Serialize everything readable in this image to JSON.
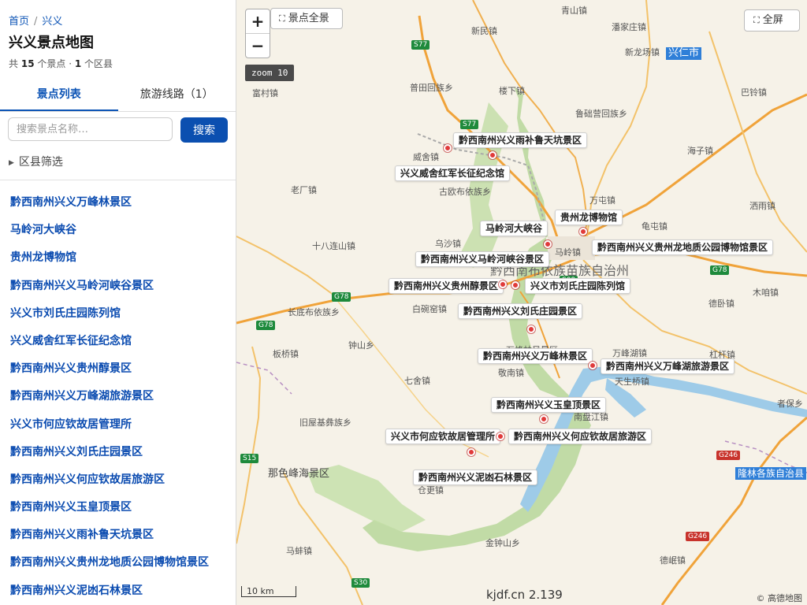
{
  "breadcrumb": {
    "home": "首页",
    "region": "兴义"
  },
  "page": {
    "title": "兴义景点地图",
    "count_prefix": "共",
    "spot_count": "15",
    "spot_unit": "个景点 ·",
    "district_count": "1",
    "district_unit": "个区县"
  },
  "tabs": [
    {
      "label": "景点列表",
      "active": true
    },
    {
      "label": "旅游线路（1）",
      "active": false
    }
  ],
  "search": {
    "placeholder": "搜索景点名称…",
    "button": "搜索"
  },
  "filter": {
    "label": "区县筛选"
  },
  "spots": [
    "黔西南州兴义万峰林景区",
    "马岭河大峡谷",
    "贵州龙博物馆",
    "黔西南州兴义马岭河峡谷景区",
    "兴义市刘氏庄园陈列馆",
    "兴义威舍红军长征纪念馆",
    "黔西南州兴义贵州醇景区",
    "黔西南州兴义万峰湖旅游景区",
    "兴义市何应钦故居管理所",
    "黔西南州兴义刘氏庄园景区",
    "黔西南州兴义何应钦故居旅游区",
    "黔西南州兴义玉皇顶景区",
    "黔西南州兴义雨补鲁天坑景区",
    "黔西南州兴义贵州龙地质公园博物馆景区",
    "黔西南州兴义泥凼石林景区"
  ],
  "map": {
    "zoom_in": "+",
    "zoom_out": "−",
    "overview_button": "景点全景",
    "fullscreen_button": "全屏",
    "zoom_badge": "zoom 10",
    "scale": "10 km",
    "watermark": "kjdf.cn 2.139",
    "copyright": "© 高德地图",
    "labels": [
      "黔西南州兴义雨补鲁天坑景区",
      "兴义威舍红军长征纪念馆",
      "贵州龙博物馆",
      "马岭河大峡谷",
      "黔西南州兴义贵州龙地质公园博物馆景区",
      "黔西南州兴义马岭河峡谷景区",
      "黔西南州兴义贵州醇景区",
      "兴义市刘氏庄园陈列馆",
      "黔西南州兴义刘氏庄园景区",
      "黔西南州兴义万峰林景区",
      "黔西南州兴义万峰湖旅游景区",
      "黔西南州兴义玉皇顶景区",
      "兴义市何应钦故居管理所",
      "黔西南州兴义何应钦故居旅游区",
      "黔西南州兴义泥凼石林景区"
    ],
    "places": [
      "青山镇",
      "潘家庄镇",
      "新民镇",
      "新龙场镇",
      "兴仁市",
      "富村镇",
      "普田回族乡",
      "楼下镇",
      "鲁础营回族乡",
      "巴铃镇",
      "海子镇",
      "威舍镇",
      "老厂镇",
      "古欧布依族乡",
      "万屯镇",
      "洒雨镇",
      "十八连山镇",
      "乌沙镇",
      "马岭镇",
      "龟屯镇",
      "长底布依族乡",
      "白碗窑镇",
      "德卧镇",
      "木咱镇",
      "板桥镇",
      "钟山乡",
      "万峰林风景区",
      "敬南镇",
      "万峰湖镇",
      "杠杆镇",
      "七舍镇",
      "天生桥镇",
      "旧屋基彝族乡",
      "南盘江镇",
      "者保乡",
      "仓更镇",
      "金钟山乡",
      "马蚌镇",
      "德岷镇",
      "那色峰海景区",
      "隆林各族自治县",
      "黔西南布依族苗族自治州"
    ],
    "highways": [
      "S77",
      "S77",
      "G78",
      "G78",
      "S15",
      "S30",
      "G246",
      "G246",
      "S09",
      "G78"
    ]
  }
}
